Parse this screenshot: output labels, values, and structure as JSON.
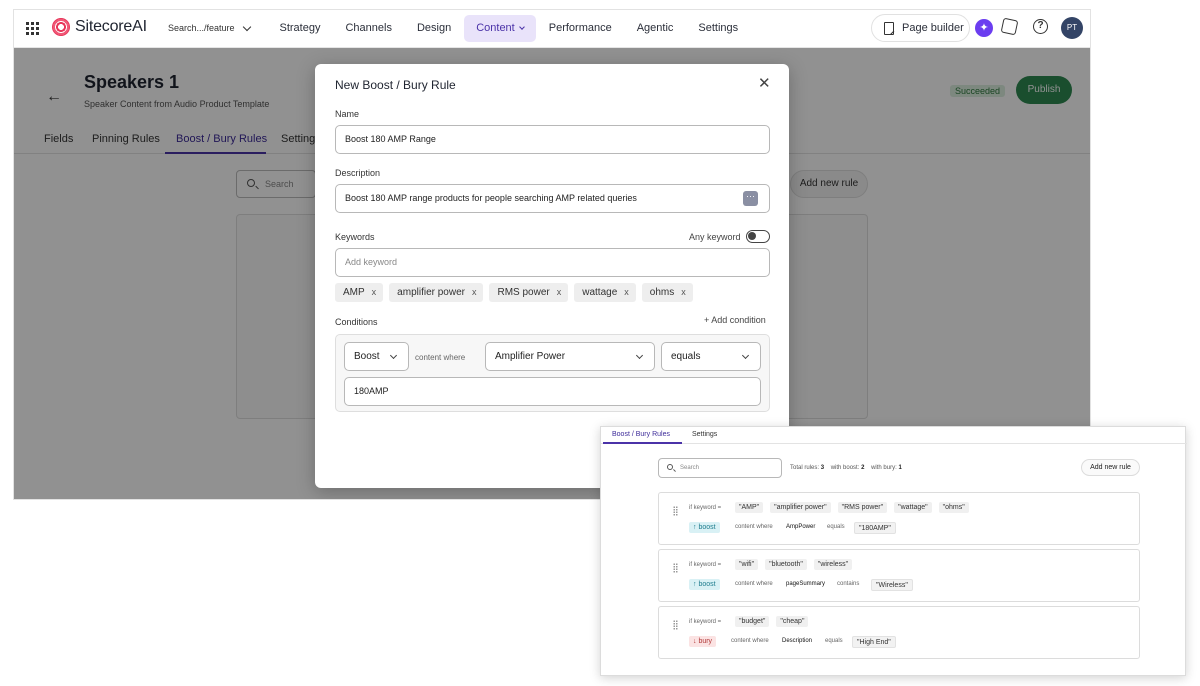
{
  "topbar": {
    "brand": "SitecoreAI",
    "site_switcher": "Search.../feature",
    "nav": [
      "Strategy",
      "Channels",
      "Design",
      "Content",
      "Performance",
      "Agentic",
      "Settings"
    ],
    "page_builder": "Page builder",
    "ai_icon": "✦",
    "avatar": "PT"
  },
  "page": {
    "title": "Speakers 1",
    "subtitle": "Speaker Content from Audio Product Template",
    "status": "Succeeded",
    "publish": "Publish",
    "tabs": [
      "Fields",
      "Pinning Rules",
      "Boost / Bury Rules",
      "Settings"
    ],
    "search_placeholder": "Search",
    "add_new_rule": "Add new rule"
  },
  "modal": {
    "title": "New Boost / Bury Rule",
    "name_label": "Name",
    "name_value": "Boost 180 AMP Range",
    "description_label": "Description",
    "description_value": "Boost 180 AMP range products for people searching AMP related queries",
    "keywords_label": "Keywords",
    "any_keyword": "Any keyword",
    "keyword_placeholder": "Add keyword",
    "keywords": [
      "AMP",
      "amplifier power",
      "RMS power",
      "wattage",
      "ohms"
    ],
    "chip_remove": "x",
    "conditions_label": "Conditions",
    "add_condition": "+ Add condition",
    "condition": {
      "action": "Boost",
      "content_where": "content where",
      "field": "Amplifier Power",
      "operator": "equals",
      "value": "180AMP"
    }
  },
  "inset": {
    "tabs": [
      "Boost / Bury Rules",
      "Settings"
    ],
    "search_placeholder": "Search",
    "stats": {
      "total_label": "Total rules:",
      "total": "3",
      "boost_label": "with boost:",
      "boost": "2",
      "bury_label": "with bury:",
      "bury": "1"
    },
    "add_new_rule": "Add new rule",
    "if_keyword": "if keyword =",
    "content_where": "content where",
    "rules": [
      {
        "keywords": [
          "\"AMP\"",
          "\"amplifier power\"",
          "\"RMS power\"",
          "\"wattage\"",
          "\"ohms\""
        ],
        "action": "↑ boost",
        "field": "AmpPower",
        "operator": "equals",
        "value": "\"180AMP\""
      },
      {
        "keywords": [
          "\"wifi\"",
          "\"bluetooth\"",
          "\"wireless\""
        ],
        "action": "↑ boost",
        "field": "pageSummary",
        "operator": "contains",
        "value": "\"Wireless\""
      },
      {
        "keywords": [
          "\"budget\"",
          "\"cheap\""
        ],
        "action": "↓ bury",
        "field": "Description",
        "operator": "equals",
        "value": "\"High End\""
      }
    ]
  }
}
